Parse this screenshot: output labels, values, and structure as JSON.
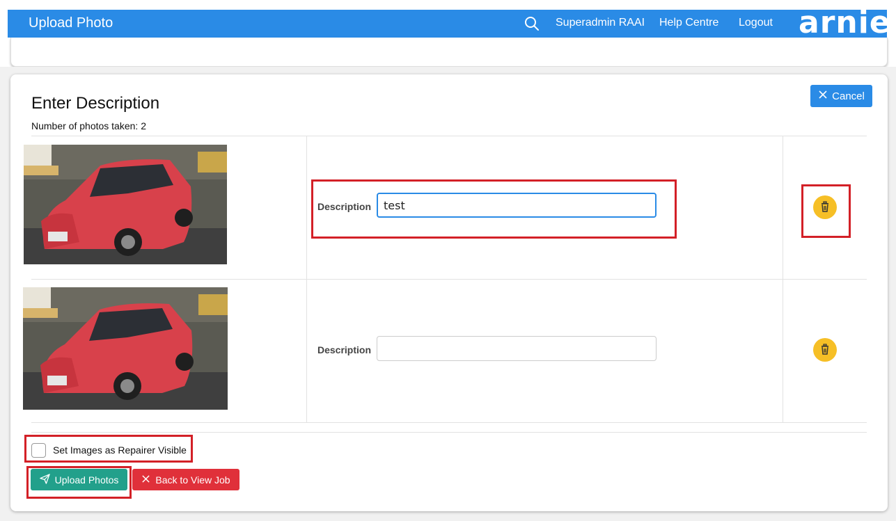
{
  "header": {
    "title": "Upload Photo",
    "search_icon": "search-icon",
    "user": "Superadmin RAAI",
    "help": "Help Centre",
    "logout": "Logout",
    "logo": "arnie",
    "bg_color": "#2a8be6"
  },
  "card": {
    "title": "Enter Description",
    "photo_count_text": "Number of photos taken: 2",
    "cancel_label": "Cancel"
  },
  "photos": [
    {
      "description_label": "Description",
      "description_value": "test",
      "delete_icon": "trash-icon"
    },
    {
      "description_label": "Description",
      "description_value": "",
      "delete_icon": "trash-icon"
    }
  ],
  "repairer_visible": {
    "label": "Set Images as Repairer Visible",
    "checked": false
  },
  "actions": {
    "upload_label": "Upload Photos",
    "back_label": "Back to View Job"
  },
  "colors": {
    "primary": "#2a8be6",
    "upload": "#22a08b",
    "back": "#e0303a",
    "delete": "#f6bf26",
    "highlight": "#d32027"
  }
}
